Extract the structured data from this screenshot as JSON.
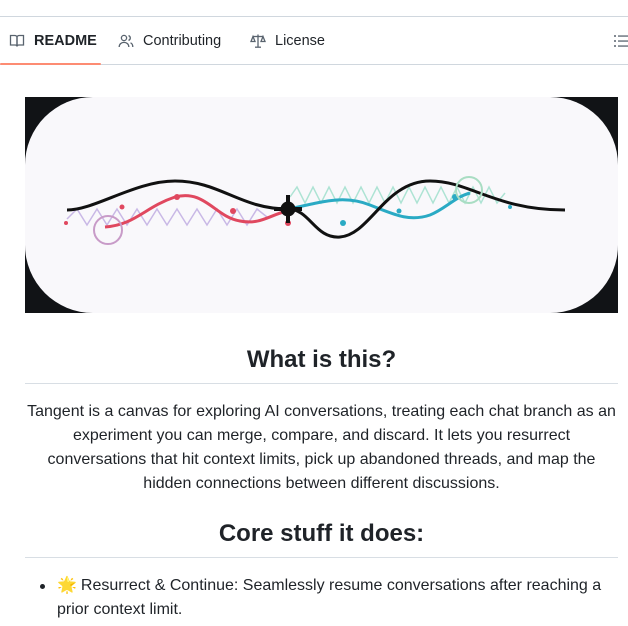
{
  "tabs": [
    {
      "label": "README",
      "icon": "book-icon",
      "active": true
    },
    {
      "label": "Contributing",
      "icon": "people-icon",
      "active": false
    },
    {
      "label": "License",
      "icon": "law-icon",
      "active": false
    }
  ],
  "toolbar": {
    "outline_icon": "list-unordered-icon"
  },
  "sections": [
    {
      "heading": "What is this?",
      "body": "Tangent is a canvas for exploring AI conversations, treating each chat branch as an experiment you can merge, compare, and discard. It lets you resurrect conversations that hit context limits, pick up abandoned threads, and map the hidden connections between different discussions."
    },
    {
      "heading": "Core stuff it does:",
      "items": [
        {
          "emoji": "🌟",
          "text": "Resurrect & Continue: Seamlessly resume conversations after reaching a prior context limit."
        }
      ]
    }
  ],
  "colors": {
    "accent": "#fd8c73",
    "wave_red": "#e0485f",
    "wave_teal": "#2aaac4",
    "wave_black": "#111111"
  }
}
